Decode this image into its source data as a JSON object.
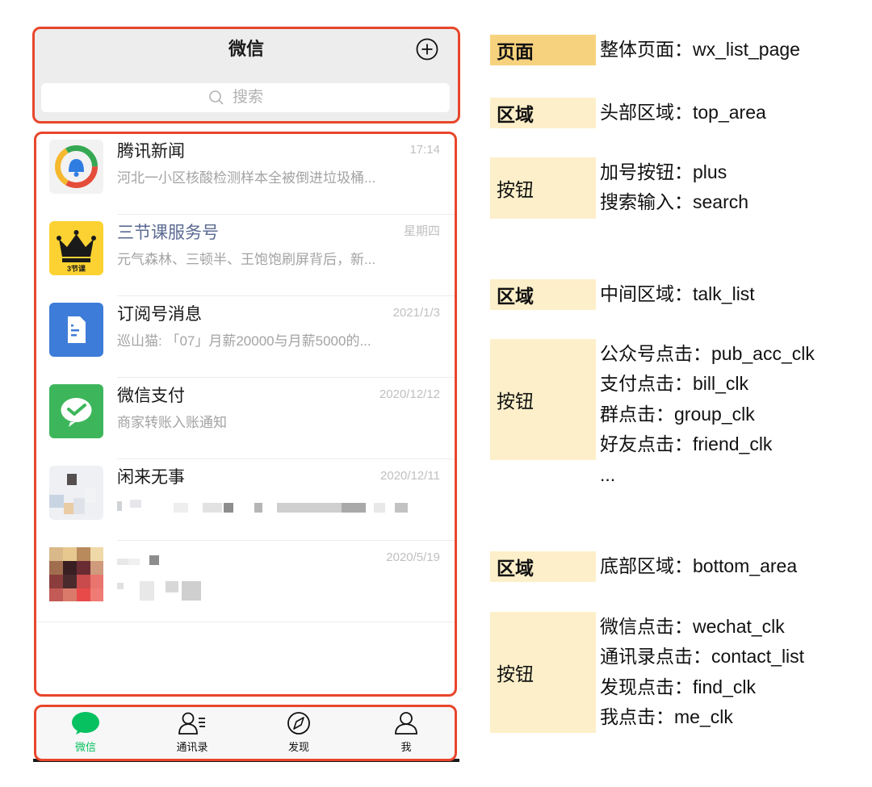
{
  "header": {
    "title": "微信",
    "search_placeholder": "搜索"
  },
  "talks": [
    {
      "name": "腾讯新闻",
      "time": "17:14",
      "message": "河北一小区核酸检测样本全被倒进垃圾桶..."
    },
    {
      "name": "三节课服务号",
      "time": "星期四",
      "message": "元气森林、三顿半、王饱饱刷屏背后，新..."
    },
    {
      "name": "订阅号消息",
      "time": "2021/1/3",
      "message": "巡山猫: 「07」月薪20000与月薪5000的..."
    },
    {
      "name": "微信支付",
      "time": "2020/12/12",
      "message": "商家转账入账通知"
    },
    {
      "name": "闲来无事",
      "time": "2020/12/11",
      "message": ""
    },
    {
      "name": "",
      "time": "2020/5/19",
      "message": ""
    }
  ],
  "tabs": [
    {
      "label": "微信",
      "icon": "chat-bubble-icon",
      "active": true
    },
    {
      "label": "通讯录",
      "icon": "contacts-icon",
      "active": false
    },
    {
      "label": "发现",
      "icon": "compass-icon",
      "active": false
    },
    {
      "label": "我",
      "icon": "person-icon",
      "active": false
    }
  ],
  "avatar_labels": {
    "sanjieke": "3节课"
  },
  "annotations": {
    "page": {
      "tag": "页面",
      "text": "整体页面：wx_list_page"
    },
    "top_region": {
      "tag": "区域",
      "text": "头部区域：top_area"
    },
    "top_buttons": {
      "tag": "按钮",
      "lines": [
        "加号按钮：plus",
        "搜索输入：search"
      ]
    },
    "middle_region": {
      "tag": "区域",
      "text": "中间区域：talk_list"
    },
    "middle_buttons": {
      "tag": "按钮",
      "lines": [
        "公众号点击：pub_acc_clk",
        "支付点击：bill_clk",
        "群点击：group_clk",
        "好友点击：friend_clk",
        "..."
      ]
    },
    "bottom_region": {
      "tag": "区域",
      "text": "底部区域：bottom_area"
    },
    "bottom_buttons": {
      "tag": "按钮",
      "lines": [
        "微信点击：wechat_clk",
        "通讯录点击：contact_list",
        "发现点击：find_clk",
        "我点击：me_clk"
      ]
    }
  },
  "colors": {
    "accent_green": "#07c160",
    "outline_red": "#e8462b",
    "tag_strong": "#f7d27e",
    "tag_light": "#fdefc9"
  }
}
